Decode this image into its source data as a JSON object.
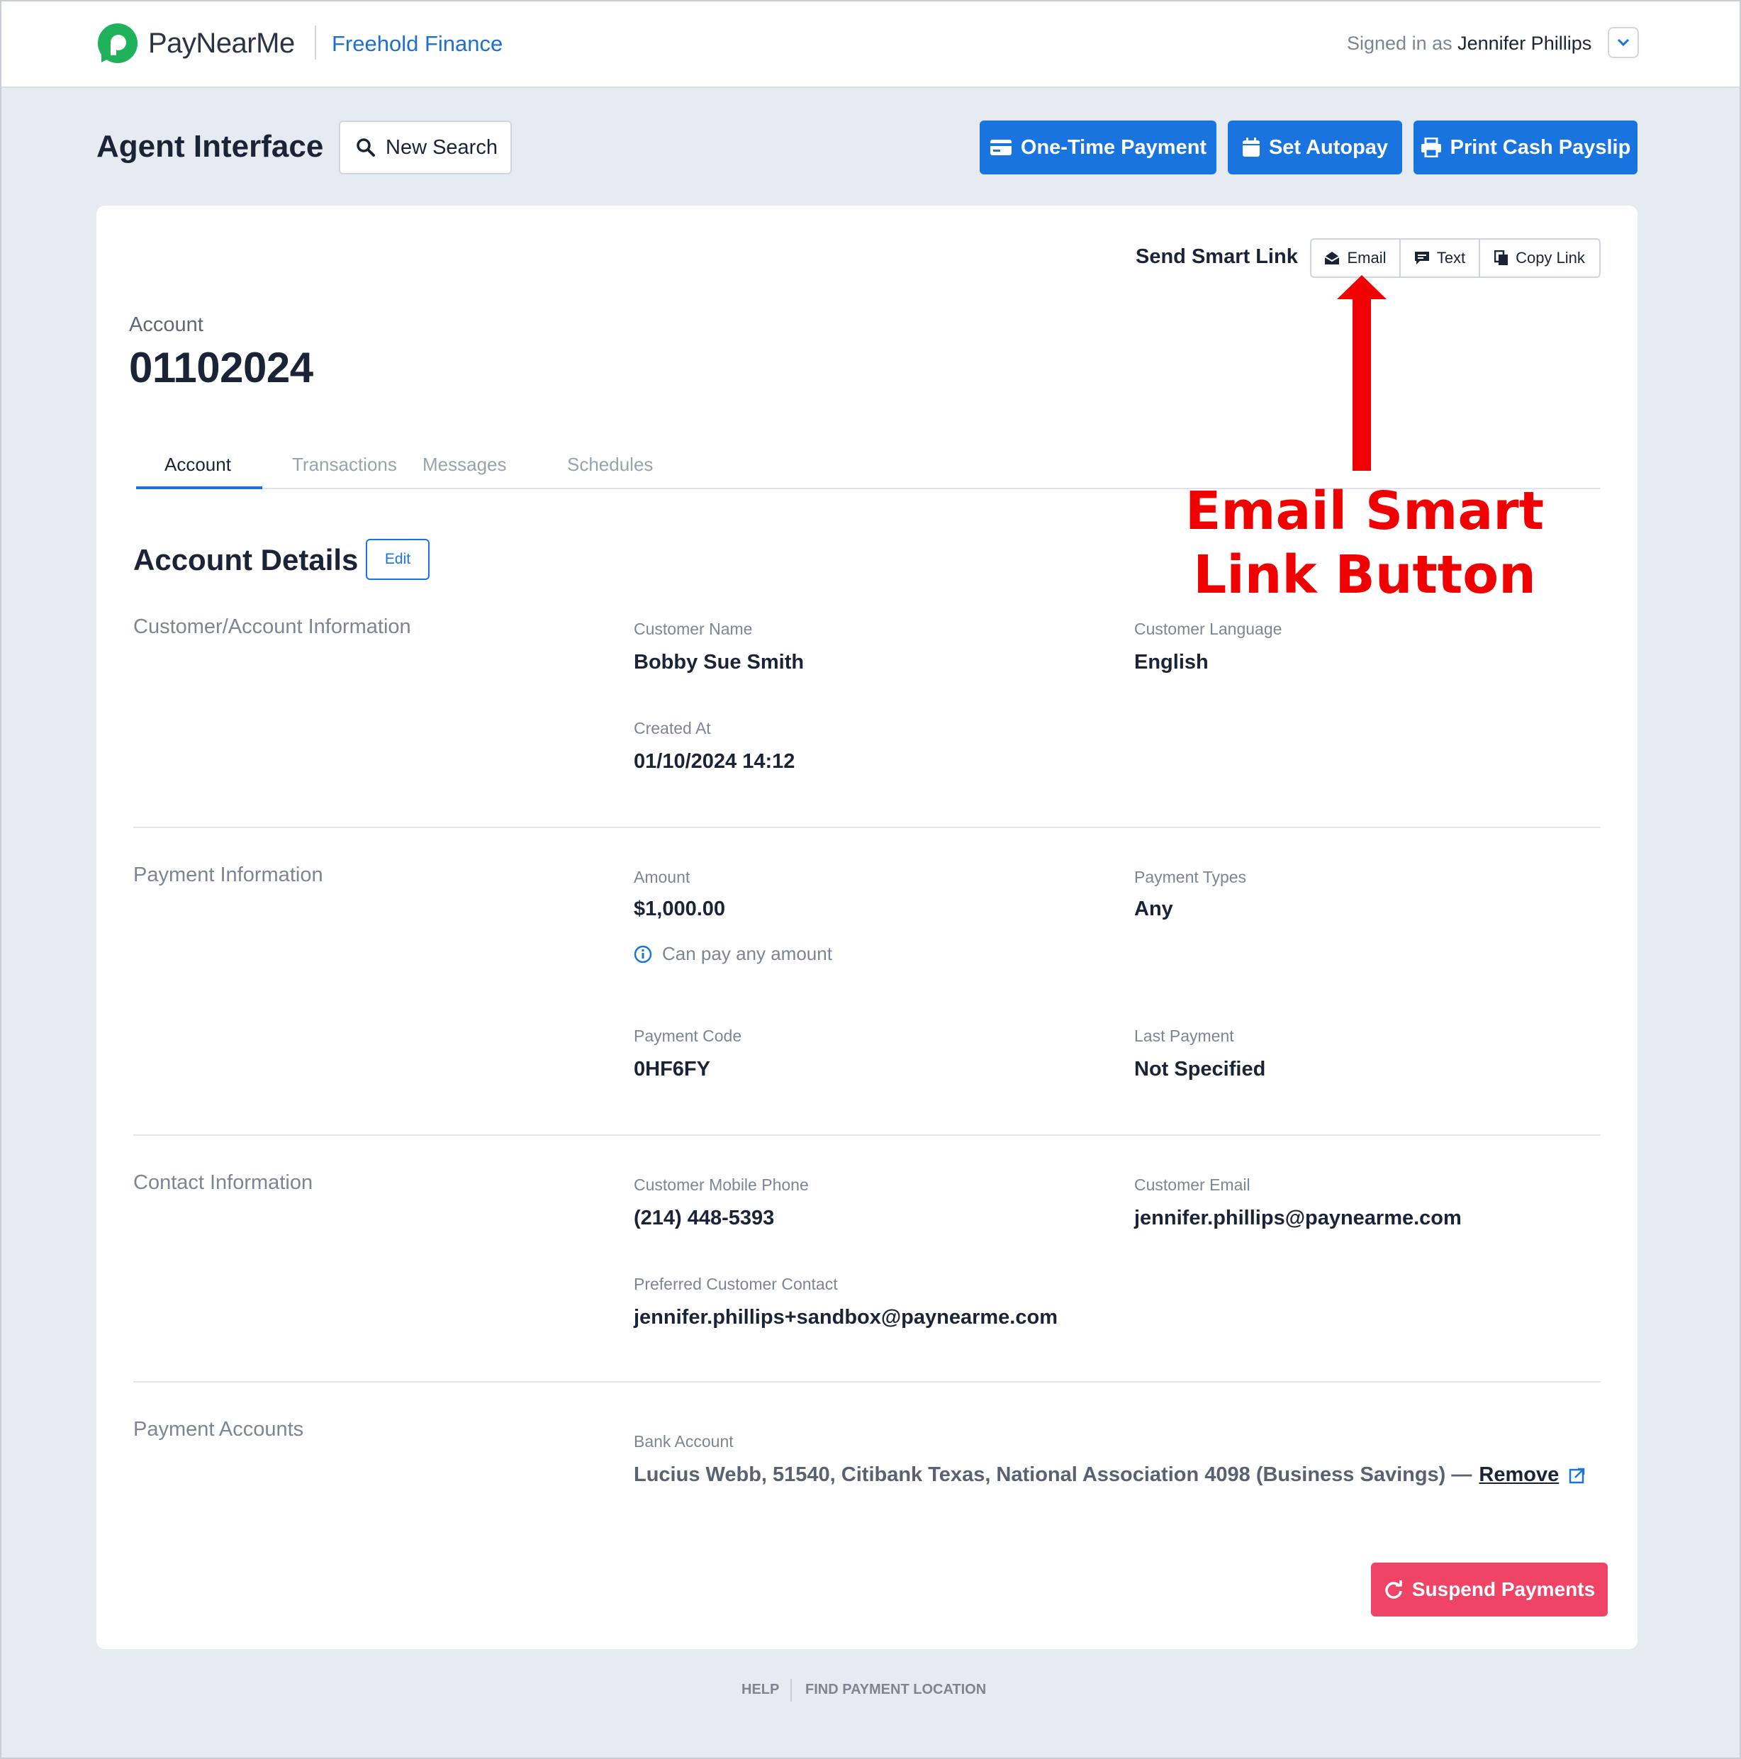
{
  "header": {
    "brand": "PayNearMe",
    "organization": "Freehold Finance",
    "signed_in_prefix": "Signed in as",
    "user_name": "Jennifer Phillips"
  },
  "toolbar": {
    "page_title": "Agent Interface",
    "new_search_label": "New Search",
    "one_time_payment_label": "One-Time Payment",
    "set_autopay_label": "Set Autopay",
    "print_payslip_label": "Print Cash Payslip"
  },
  "smart_link": {
    "label": "Send Smart Link",
    "email_label": "Email",
    "text_label": "Text",
    "copy_label": "Copy Link"
  },
  "account": {
    "label": "Account",
    "number": "01102024"
  },
  "tabs": [
    {
      "label": "Account",
      "active": true
    },
    {
      "label": "Transactions",
      "active": false
    },
    {
      "label": "Messages",
      "active": false
    },
    {
      "label": "Schedules",
      "active": false
    }
  ],
  "details": {
    "title": "Account Details",
    "edit_label": "Edit"
  },
  "customer_info": {
    "section_title": "Customer/Account Information",
    "customer_name_label": "Customer Name",
    "customer_name": "Bobby Sue Smith",
    "language_label": "Customer Language",
    "language": "English",
    "created_label": "Created At",
    "created": "01/10/2024 14:12"
  },
  "payment_info": {
    "section_title": "Payment Information",
    "amount_label": "Amount",
    "amount": "$1,000.00",
    "amount_note": "Can pay any amount",
    "types_label": "Payment Types",
    "types": "Any",
    "code_label": "Payment Code",
    "code": "0HF6FY",
    "last_label": "Last Payment",
    "last": "Not Specified"
  },
  "contact_info": {
    "section_title": "Contact Information",
    "phone_label": "Customer Mobile Phone",
    "phone": "(214) 448-5393",
    "email_label": "Customer Email",
    "email": "jennifer.phillips@paynearme.com",
    "preferred_label": "Preferred Customer Contact",
    "preferred": "jennifer.phillips+sandbox@paynearme.com"
  },
  "payment_accounts": {
    "section_title": "Payment Accounts",
    "bank_label": "Bank Account",
    "bank_value": "Lucius Webb, 51540, Citibank Texas, National Association 4098 (Business Savings) —",
    "remove_label": "Remove"
  },
  "actions": {
    "suspend_label": "Suspend Payments"
  },
  "annotation": {
    "line1": "Email Smart",
    "line2": "Link Button",
    "color": "#f00000"
  },
  "footer": {
    "help": "HELP",
    "find_location": "FIND PAYMENT LOCATION"
  },
  "colors": {
    "primary": "#1a74e0",
    "danger": "#ef4465",
    "brand_green": "#1fb25a"
  }
}
